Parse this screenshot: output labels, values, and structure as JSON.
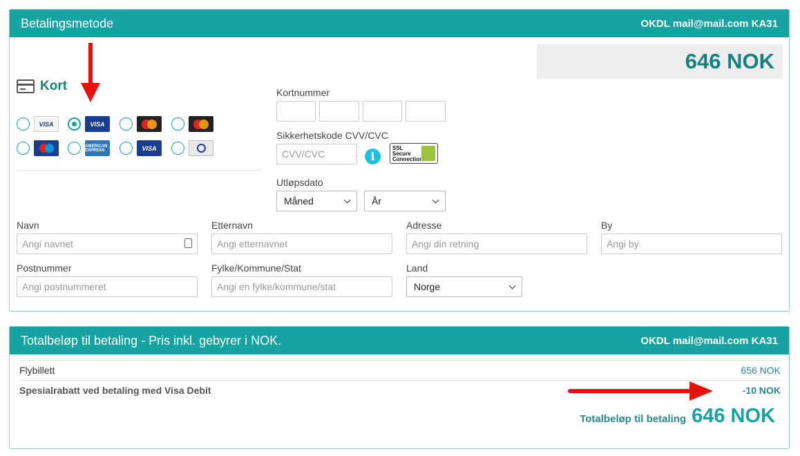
{
  "payment": {
    "header_title": "Betalingsmetode",
    "account": "OKDL mail@mail.com KA31",
    "amount": "646 NOK",
    "card_title": "Kort",
    "brands": [
      {
        "name": "visa-credit-logo",
        "text": "VISA",
        "checked": false
      },
      {
        "name": "visa-debit-logo",
        "text": "VISA",
        "checked": true
      },
      {
        "name": "mastercard-debit-logo",
        "text": "",
        "checked": false
      },
      {
        "name": "mastercard-logo",
        "text": "",
        "checked": false
      },
      {
        "name": "maestro-logo",
        "text": "",
        "checked": false
      },
      {
        "name": "american-express-logo",
        "text": "AMERICAN EXPRESS",
        "checked": false
      },
      {
        "name": "visa-electron-logo",
        "text": "VISA",
        "checked": false
      },
      {
        "name": "diners-club-logo",
        "text": "",
        "checked": false
      }
    ],
    "card_number_label": "Kortnummer",
    "cvv_label": "Sikkerhetskode CVV/CVC",
    "cvv_placeholder": "CVV/CVC",
    "ssl_text": "SSL Secure Connection",
    "expiry_label": "Utløpsdato",
    "month_select": "Måned",
    "year_select": "År",
    "first_name_label": "Navn",
    "first_name_placeholder": "Angi navnet",
    "last_name_label": "Etternavn",
    "last_name_placeholder": "Angi etternavnet",
    "address_label": "Adresse",
    "address_placeholder": "Angi din retning",
    "city_label": "By",
    "city_placeholder": "Angi by",
    "postcode_label": "Postnummer",
    "postcode_placeholder": "Angi postnummeret",
    "county_label": "Fylke/Kommune/Stat",
    "county_placeholder": "Angi en fylke/kommune/stat",
    "country_label": "Land",
    "country_value": "Norge"
  },
  "total": {
    "header_title": "Totalbeløp til betaling - Pris inkl. gebyrer i NOK.",
    "account": "OKDL mail@mail.com KA31",
    "lines": [
      {
        "label": "Flybillett",
        "value": "656 NOK"
      },
      {
        "label": "Spesialrabatt ved betaling med Visa Debit",
        "value": "-10 NOK"
      }
    ],
    "total_label": "Totalbeløp til betaling",
    "total_value": "646 NOK"
  },
  "colors": {
    "accent": "#16a3a1",
    "annotation_arrow": "#e8120c"
  }
}
